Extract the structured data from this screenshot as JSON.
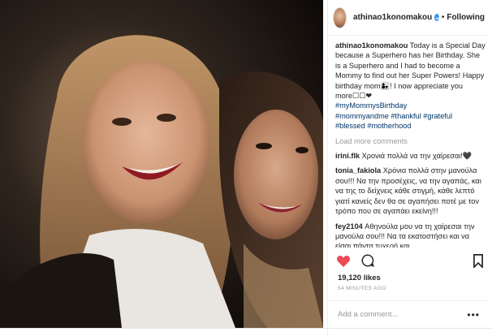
{
  "post": {
    "username": "athinao1konomakou",
    "follow_label": "Following",
    "dot": "•",
    "caption": {
      "username": "athinao1konomakou",
      "text": " Today is a Special Day because a Superhero has her Birthday. She is a Superhero and I had to become a Mommy to find out her Super Powers! Happy birthday mom👩‍👧! I now appreciate you more☐☐❤",
      "hashtags_line1": "#myMommysBirthday",
      "hashtags_line2": "#mommyandme #thankful #grateful",
      "hashtags_line3": "#blessed #motherhood"
    },
    "load_more": "Load more comments",
    "comments": [
      {
        "user": "irini.flk",
        "text": " Χρονιά πολλά να την χαίρεσαι!🖤"
      },
      {
        "user": "tonia_fakiola",
        "text": " Χρόνια πολλά στην μανούλα σου!!! Να την προσέχεις, να την αγαπάς, και να της το δείχνεις κάθε στιγμή, κάθε λεπτό γιατί κανείς δεν θα σε αγαπήσει ποτέ με τον τρόπο που σε αγαπάει εκείνη!!!"
      },
      {
        "user": "fey2104",
        "text": " Αθηνούλα μου να τη χαίρεσαι την μανούλα σου!!! Να τα εκατοστήσει και να είσαι πάντα τυχερή και..."
      }
    ],
    "likes": "19,120 likes",
    "time_ago": "54 MINUTES AGO",
    "add_comment_placeholder": "Add a comment...",
    "more_menu": "•••"
  },
  "icons": {
    "heart": "heart-icon",
    "comment": "comment-icon",
    "bookmark": "bookmark-icon",
    "verified": "verified-badge-icon"
  },
  "colors": {
    "heart": "#ed4956",
    "verified": "#3897f0",
    "hashtag": "#003569",
    "muted": "#999999"
  }
}
